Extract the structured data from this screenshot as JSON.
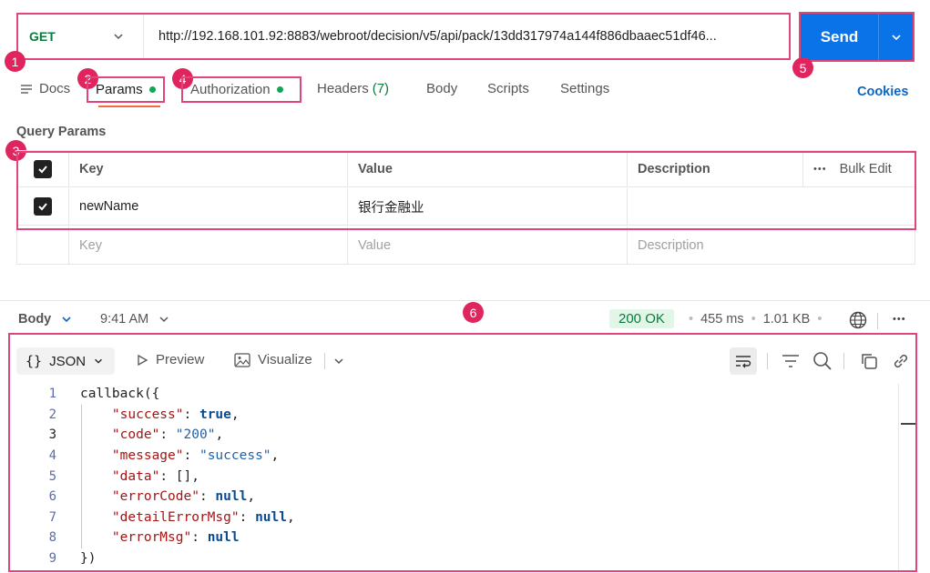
{
  "request": {
    "method": "GET",
    "url": "http://192.168.101.92:8883/webroot/decision/v5/api/pack/13dd317974a144f886dbaaec51df46...",
    "send_label": "Send"
  },
  "badges": [
    "1",
    "2",
    "3",
    "4",
    "5",
    "6"
  ],
  "tabs": {
    "docs": "Docs",
    "params": "Params",
    "authorization": "Authorization",
    "headers": "Headers",
    "headers_count": "(7)",
    "body": "Body",
    "scripts": "Scripts",
    "settings": "Settings",
    "cookies": "Cookies"
  },
  "query_params": {
    "title": "Query Params",
    "headers": {
      "key": "Key",
      "value": "Value",
      "description": "Description",
      "bulk_edit": "Bulk Edit"
    },
    "rows": [
      {
        "checked": true,
        "key": "newName",
        "value": "银行金融业",
        "description": ""
      }
    ],
    "placeholder": {
      "key": "Key",
      "value": "Value",
      "description": "Description"
    }
  },
  "response": {
    "body_label": "Body",
    "time_label": "9:41 AM",
    "status": "200 OK",
    "duration": "455 ms",
    "size": "1.01 KB",
    "format": "JSON",
    "preview": "Preview",
    "visualize": "Visualize",
    "code_lines": [
      {
        "n": "1",
        "t": "callback({"
      },
      {
        "n": "2",
        "key": "\"success\"",
        "sep": ": ",
        "val": "true",
        "type": "b",
        "end": ","
      },
      {
        "n": "3",
        "key": "\"code\"",
        "sep": ": ",
        "val": "\"200\"",
        "type": "s",
        "end": ","
      },
      {
        "n": "4",
        "key": "\"message\"",
        "sep": ": ",
        "val": "\"success\"",
        "type": "s",
        "end": ","
      },
      {
        "n": "5",
        "key": "\"data\"",
        "sep": ": ",
        "val": "[]",
        "type": "p",
        "end": ","
      },
      {
        "n": "6",
        "key": "\"errorCode\"",
        "sep": ": ",
        "val": "null",
        "type": "b",
        "end": ","
      },
      {
        "n": "7",
        "key": "\"detailErrorMsg\"",
        "sep": ": ",
        "val": "null",
        "type": "b",
        "end": ","
      },
      {
        "n": "8",
        "key": "\"errorMsg\"",
        "sep": ": ",
        "val": "null",
        "type": "b",
        "end": ""
      },
      {
        "n": "9",
        "t": "})"
      }
    ]
  },
  "colors": {
    "accent": "#0b73e8",
    "highlight": "#e0457b",
    "badge": "#e0245e",
    "ok": "#0b7a3e"
  }
}
